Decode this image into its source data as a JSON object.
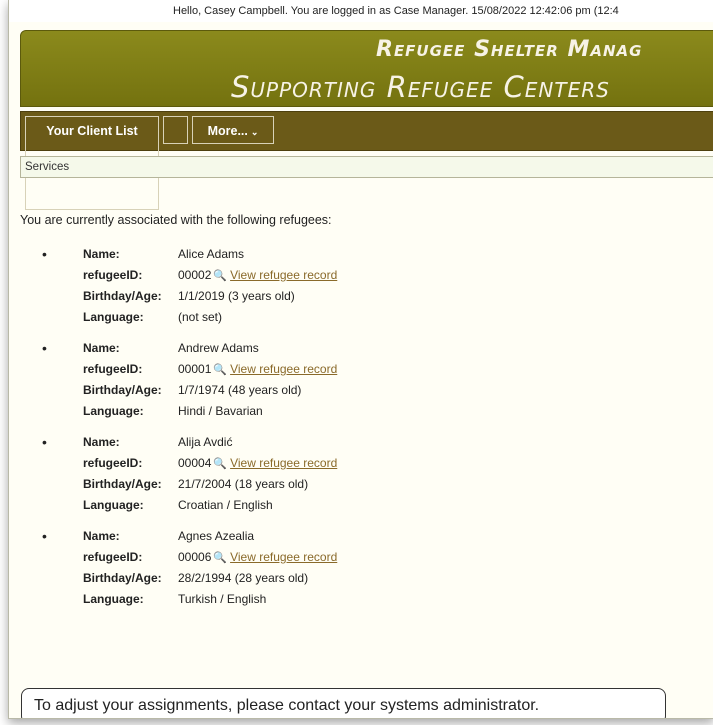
{
  "topbar": {
    "text": "Hello, Casey Campbell. You are logged in as Case Manager. 15/08/2022 12:42:06 pm (12:4"
  },
  "banner": {
    "title": "Refugee Shelter Manag",
    "subtitle": "Supporting Refugee Centers"
  },
  "nav": {
    "client_list": "Your Client List",
    "more": "More...",
    "more_icon": "chevron-down"
  },
  "breadcrumb": "Services",
  "intro": "You are currently associated with the following refugees:",
  "labels": {
    "name": "Name:",
    "id": "refugeeID:",
    "birthday": "Birthday/Age:",
    "language": "Language:",
    "view": "View refugee record"
  },
  "clients": [
    {
      "name": "Alice Adams",
      "id": "00002",
      "birthday": "1/1/2019 (3 years old)",
      "language": "(not set)"
    },
    {
      "name": "Andrew Adams",
      "id": "00001",
      "birthday": "1/7/1974 (48 years old)",
      "language": "Hindi / Bavarian"
    },
    {
      "name": "Alija Avdić",
      "id": "00004",
      "birthday": "21/7/2004 (18 years old)",
      "language": "Croatian / English"
    },
    {
      "name": "Agnes Azealia",
      "id": "00006",
      "birthday": "28/2/1994 (28 years old)",
      "language": "Turkish / English"
    }
  ],
  "notice": "To adjust your assignments, please contact your systems administrator.",
  "colors": {
    "banner": "#7f7e16",
    "nav": "#6b5a18",
    "link": "#8a6a2a",
    "page": "#fffef5"
  }
}
